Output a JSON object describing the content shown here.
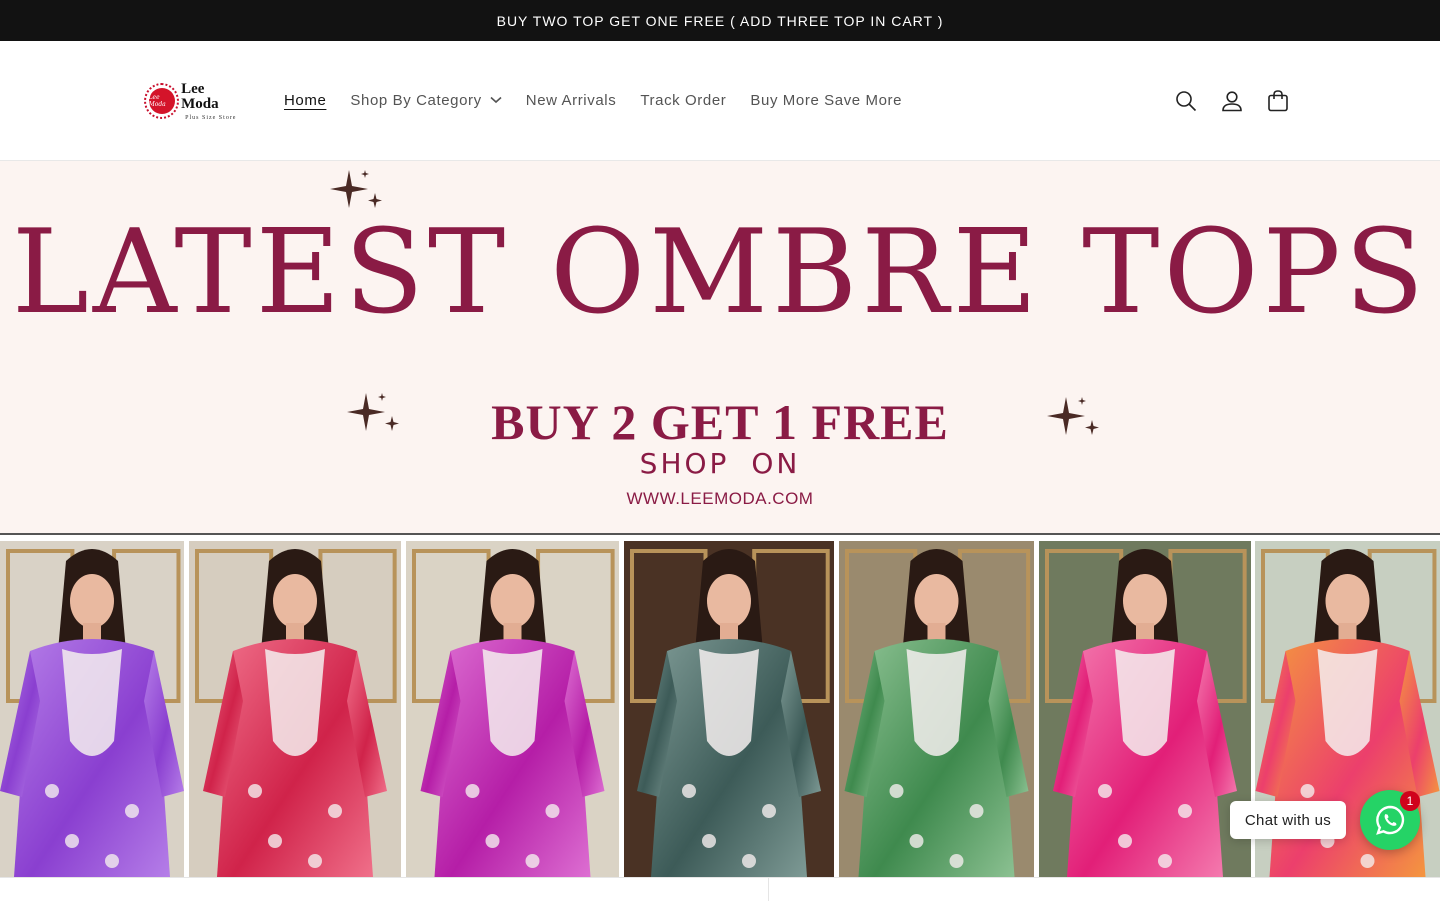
{
  "announcement": {
    "text": "BUY TWO TOP GET ONE FREE ( ADD THREE TOP IN CART )"
  },
  "logo": {
    "name": "Lee Moda",
    "tagline": "Plus  Size  Store",
    "mark_text": "Lee Moda"
  },
  "nav": {
    "items": [
      {
        "label": "Home",
        "active": true
      },
      {
        "label": "Shop By Category",
        "has_dropdown": true
      },
      {
        "label": "New Arrivals"
      },
      {
        "label": "Track Order"
      },
      {
        "label": "Buy More Save More"
      }
    ]
  },
  "header_icons": [
    "search-icon",
    "account-icon",
    "cart-icon"
  ],
  "hero": {
    "title": "LATEST OMBRE TOPS",
    "offer": "BUY 2 GET 1 FREE",
    "shop": "SHOP ON",
    "url": "WWW.LEEMODA.COM",
    "colors": {
      "text": "#8a1b45",
      "background": "#fcf4f1"
    }
  },
  "gallery": {
    "tops": [
      {
        "color": "#8a3fd0",
        "light": "#b57ee8"
      },
      {
        "color": "#d0234a",
        "light": "#f0708a"
      },
      {
        "color": "#b51ea7",
        "light": "#dd6fd2"
      },
      {
        "color": "#3d5b58",
        "light": "#7e9a95"
      },
      {
        "color": "#3f8a4e",
        "light": "#8cc192"
      },
      {
        "color": "#e21f78",
        "light": "#f47aae"
      },
      {
        "color": "#ec3f6c",
        "light": "#f4963f"
      }
    ]
  },
  "chat": {
    "label": "Chat with us",
    "badge": "1",
    "color": "#25d366"
  }
}
